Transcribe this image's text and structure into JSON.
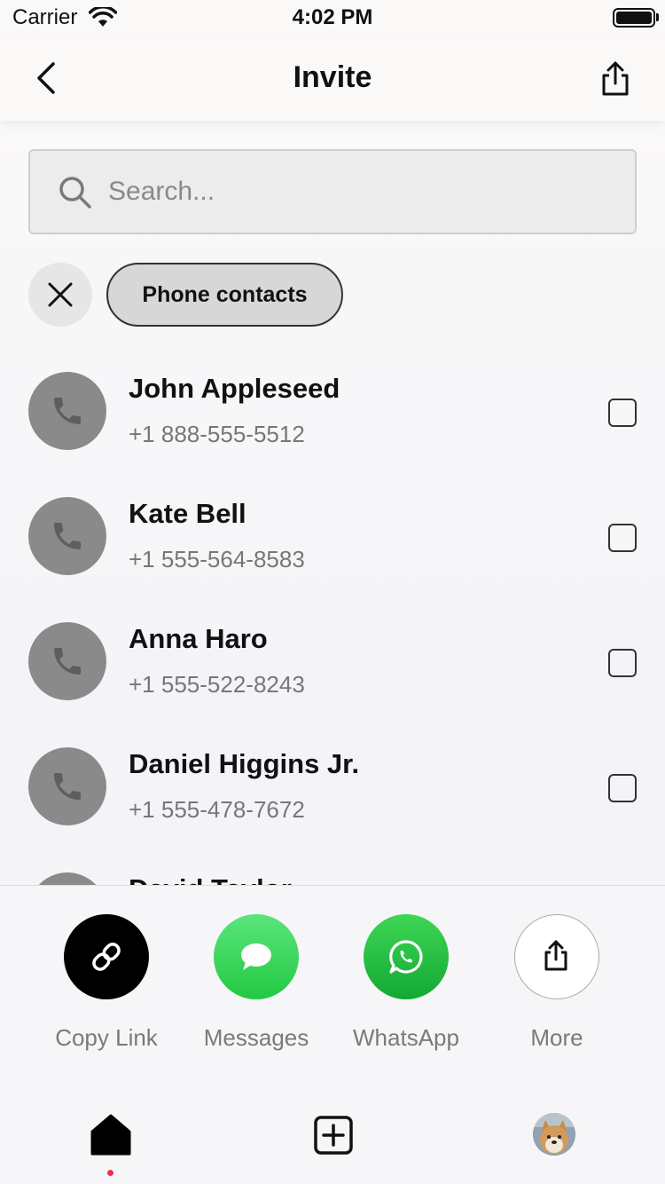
{
  "status_bar": {
    "carrier": "Carrier",
    "time": "4:02 PM"
  },
  "nav": {
    "title": "Invite",
    "back_icon": "chevron-left-icon",
    "share_icon": "share-icon"
  },
  "search": {
    "placeholder": "Search...",
    "value": ""
  },
  "filters": {
    "clear_icon": "close-icon",
    "active_filter": "Phone contacts"
  },
  "contacts": [
    {
      "name": "John Appleseed",
      "phone": "+1 888-555-5512",
      "selected": false
    },
    {
      "name": "Kate Bell",
      "phone": "+1 555-564-8583",
      "selected": false
    },
    {
      "name": "Anna Haro",
      "phone": "+1 555-522-8243",
      "selected": false
    },
    {
      "name": "Daniel Higgins Jr.",
      "phone": "+1 555-478-7672",
      "selected": false
    },
    {
      "name": "David Taylor",
      "phone": "",
      "selected": false
    }
  ],
  "share_options": [
    {
      "label": "Copy Link",
      "icon": "link-icon",
      "color": "#000000"
    },
    {
      "label": "Messages",
      "icon": "message-bubble-icon",
      "color": "#2fd158"
    },
    {
      "label": "WhatsApp",
      "icon": "whatsapp-icon",
      "color": "#1fb83f"
    },
    {
      "label": "More",
      "icon": "share-icon",
      "color": "#ffffff"
    }
  ],
  "tab_bar": {
    "items": [
      {
        "icon": "home-icon",
        "active": true
      },
      {
        "icon": "add-square-icon",
        "active": false
      },
      {
        "icon": "profile-avatar",
        "active": false
      }
    ],
    "active_indicator_color": "#e8344b"
  }
}
